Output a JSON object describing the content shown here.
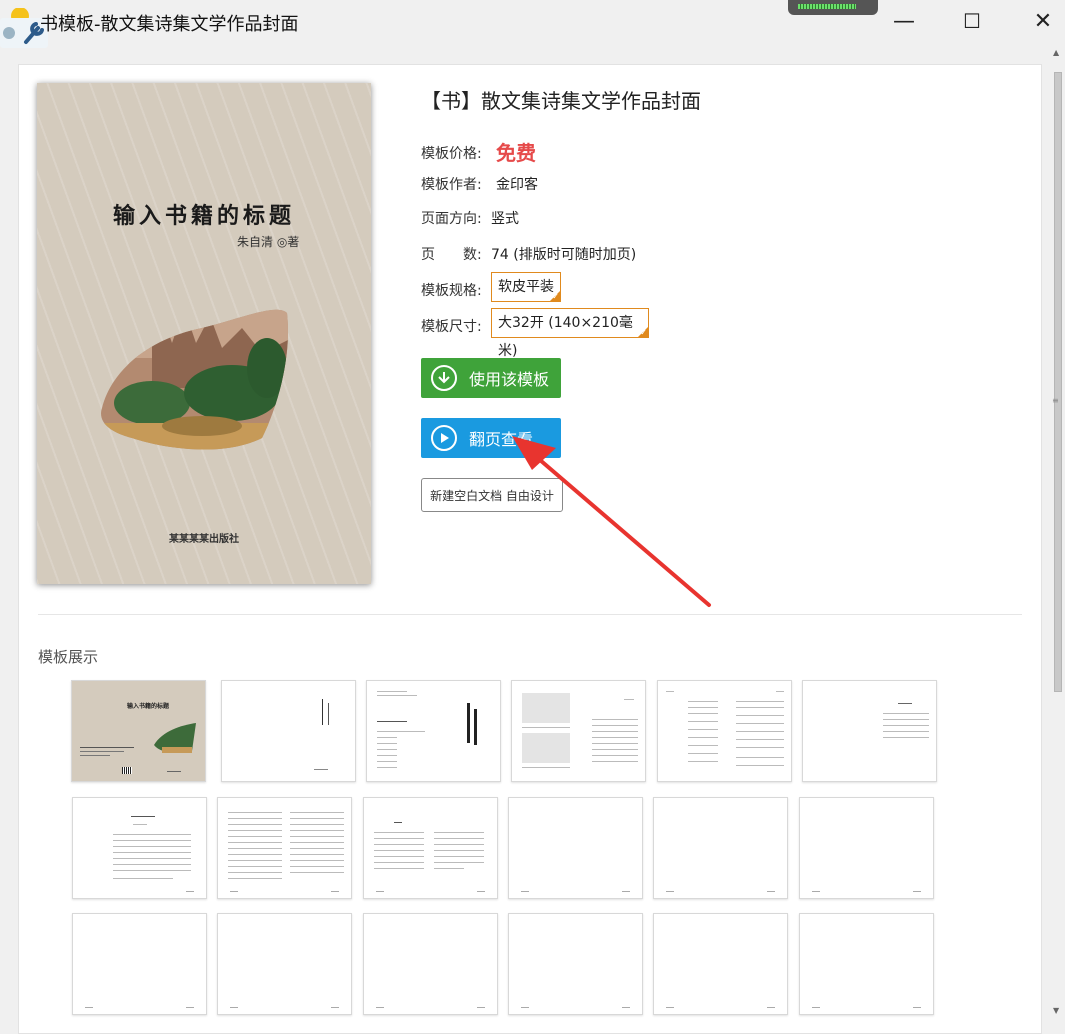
{
  "window": {
    "title": "书模板-散文集诗集文学作品封面",
    "minimize": "—",
    "maximize": "☐",
    "close": "✕"
  },
  "cover": {
    "title": "输入书籍的标题",
    "author": "朱自清 ◎著",
    "publisher": "某某某某出版社"
  },
  "info": {
    "title": "【书】散文集诗集文学作品封面",
    "price_label": "模板价格:",
    "price_value": "免费",
    "author_label": "模板作者:",
    "author_value": "金印客",
    "orientation_label": "页面方向:",
    "orientation_value": "竖式",
    "pages_label": "页　　数:",
    "pages_value": "74 (排版时可随时加页)",
    "spec_label": "模板规格:",
    "spec_value": "软皮平装",
    "size_label": "模板尺寸:",
    "size_value": "大32开 (140×210毫米)"
  },
  "buttons": {
    "use_template": "使用该模板",
    "flip_preview": "翻页查看",
    "blank_doc": "新建空白文档 自由设计"
  },
  "gallery": {
    "title": "模板展示",
    "thumb1_title": "输入书籍的标题"
  },
  "colors": {
    "accent_green": "#3fa33a",
    "accent_blue": "#1a9ae0",
    "price_red": "#e64a4a",
    "spec_border": "#e08a1e",
    "arrow_red": "#e8342f"
  }
}
